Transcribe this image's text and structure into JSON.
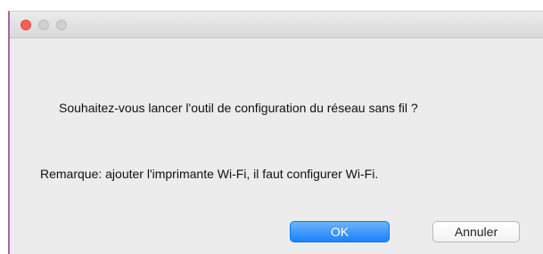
{
  "window": {
    "title": ""
  },
  "dialog": {
    "question": "Souhaitez-vous lancer l'outil de configuration du réseau sans fil ?",
    "note": "Remarque: ajouter l'imprimante Wi-Fi, il faut configurer Wi-Fi.",
    "ok_label": "OK",
    "cancel_label": "Annuler"
  },
  "colors": {
    "close": "#fc5f57",
    "primary": "#1a82fb",
    "window_bg": "#ececec"
  },
  "icons": {
    "close": "close-icon",
    "minimize": "minimize-icon",
    "zoom": "zoom-icon"
  }
}
